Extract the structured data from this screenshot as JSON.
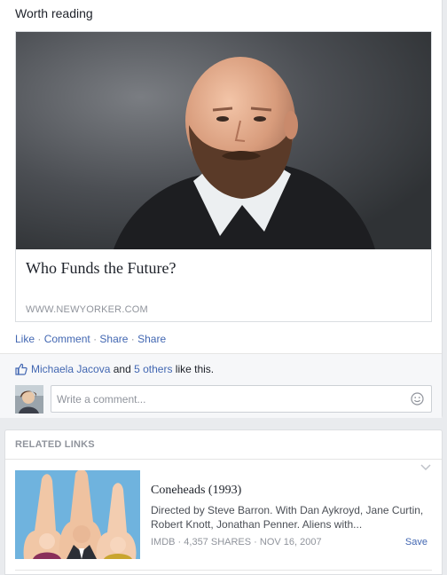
{
  "post": {
    "header": "Worth reading",
    "link": {
      "title": "Who Funds the Future?",
      "domain": "WWW.NEWYORKER.COM"
    },
    "actions": [
      "Like",
      "Comment",
      "Share",
      "Share"
    ],
    "likes": {
      "name": "Michaela Jacova",
      "and": " and ",
      "others": "5 others",
      "suffix": " like this."
    },
    "comment_placeholder": "Write a comment..."
  },
  "related": {
    "header": "RELATED LINKS",
    "items": [
      {
        "title": "Coneheads (1993)",
        "description": "Directed by Steve Barron. With Dan Aykroyd, Jane Curtin, Robert Knott, Jonathan Penner. Aliens with...",
        "meta": "IMDB · 4,357 SHARES · NOV 16, 2007",
        "save": "Save"
      }
    ]
  },
  "colors": {
    "link_blue": "#4267b2",
    "muted": "#90949c",
    "page_bg": "#e9ebee"
  },
  "icons": [
    "thumbs-up-icon",
    "smiley-icon",
    "chevron-down-icon"
  ]
}
